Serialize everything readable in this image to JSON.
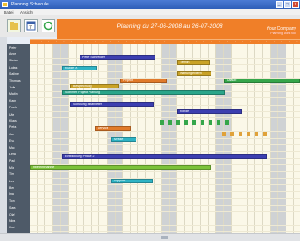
{
  "window": {
    "title": "Planning Schedule"
  },
  "menu": [
    "Datei",
    "Ansicht"
  ],
  "header": {
    "planning_text": "Planning du 27-06-2008 au 26-07-2008",
    "company": "Your Company",
    "company_sub": "Planning work tool"
  },
  "colors": {
    "accent": "#f07f28",
    "title_bar": "#2f5fb8"
  },
  "toolbar": {
    "icons": [
      "open-file-icon",
      "calendar-icon",
      "refresh-icon"
    ]
  },
  "rows": [
    "Peter",
    "Anne",
    "Stefan",
    "Lukas",
    "Sabine",
    "Thomas",
    "Julia",
    "Martin",
    "Karin",
    "Frank",
    "Ute",
    "Klaus",
    "Petra",
    "Jan",
    "Eva",
    "Max",
    "Lena",
    "Paul",
    "Mia",
    "Tim",
    "Lea",
    "Ben",
    "Ina",
    "Tom",
    "Sara",
    "Olaf",
    "Nina",
    "Kurt"
  ],
  "bars": [
    {
      "label": "Peter Schneider",
      "color": "#3c3fb0"
    },
    {
      "label": "Kunde X",
      "color": "#2fb3c4"
    },
    {
      "label": "Termin",
      "color": "#c9a227"
    },
    {
      "label": "Wartung extern",
      "color": "#c9a227"
    },
    {
      "label": "Projekt",
      "color": "#e07a2a"
    },
    {
      "label": "Besprechung",
      "color": "#c9a227"
    },
    {
      "label": "Urlaub",
      "color": "#35a64a"
    },
    {
      "label": "Sommer Projekt Planung",
      "color": "#2aa58a"
    },
    {
      "label": "Schulung Mitarbeiter",
      "color": "#3c3fb0"
    },
    {
      "label": "Kunde",
      "color": "#3c3fb0"
    },
    {
      "label": "Service",
      "color": "#e07a2a"
    },
    {
      "label": "Messe",
      "color": "#2fb3c4"
    },
    {
      "label": "Entwicklung Phase 2",
      "color": "#3c3fb0"
    },
    {
      "label": "Inbetriebnahme",
      "color": "#7cc23a"
    },
    {
      "label": "Support",
      "color": "#2fb3c4"
    }
  ]
}
